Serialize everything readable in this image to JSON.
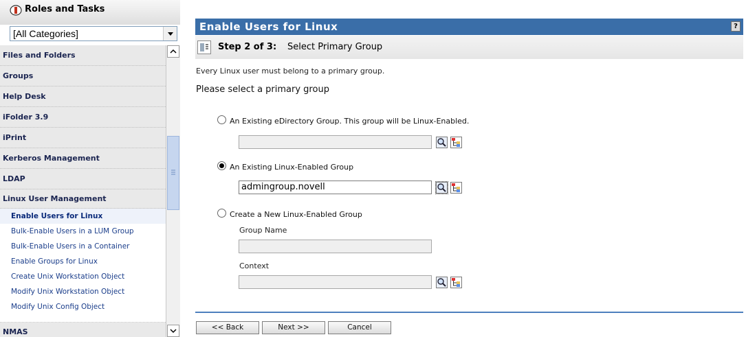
{
  "sidebar": {
    "title": "Roles and Tasks",
    "category_value": "[All Categories]",
    "items": [
      {
        "label": "Files and Folders"
      },
      {
        "label": "Groups"
      },
      {
        "label": "Help Desk"
      },
      {
        "label": "iFolder 3.9"
      },
      {
        "label": "iPrint"
      },
      {
        "label": "Kerberos Management"
      },
      {
        "label": "LDAP"
      },
      {
        "label": "Linux User Management"
      }
    ],
    "subitems": [
      {
        "label": "Enable Users for Linux",
        "active": true
      },
      {
        "label": "Bulk-Enable Users in a LUM Group"
      },
      {
        "label": "Bulk-Enable Users in a Container"
      },
      {
        "label": "Enable Groups for Linux"
      },
      {
        "label": "Create Unix Workstation Object"
      },
      {
        "label": "Modify Unix Workstation Object"
      },
      {
        "label": "Modify Unix Config Object"
      }
    ],
    "last_item": "NMAS"
  },
  "main": {
    "title": "Enable Users for Linux",
    "help": "?",
    "step_label": "Step 2 of 3:",
    "step_desc": "Select Primary Group",
    "intro": "Every Linux user must belong to a primary group.",
    "prompt": "Please select a primary group",
    "options": [
      {
        "label": "An Existing eDirectory Group. This group will be Linux-Enabled.",
        "checked": false,
        "value": ""
      },
      {
        "label": "An Existing Linux-Enabled Group",
        "checked": true,
        "value": "admingroup.novell"
      },
      {
        "label": "Create a New Linux-Enabled Group",
        "checked": false
      }
    ],
    "group_name_label": "Group Name",
    "context_label": "Context"
  },
  "buttons": {
    "back": "<< Back",
    "next": "Next >>",
    "cancel": "Cancel"
  },
  "colors": {
    "banner": "#3a6ea8",
    "divider": "#4d7fbd"
  }
}
